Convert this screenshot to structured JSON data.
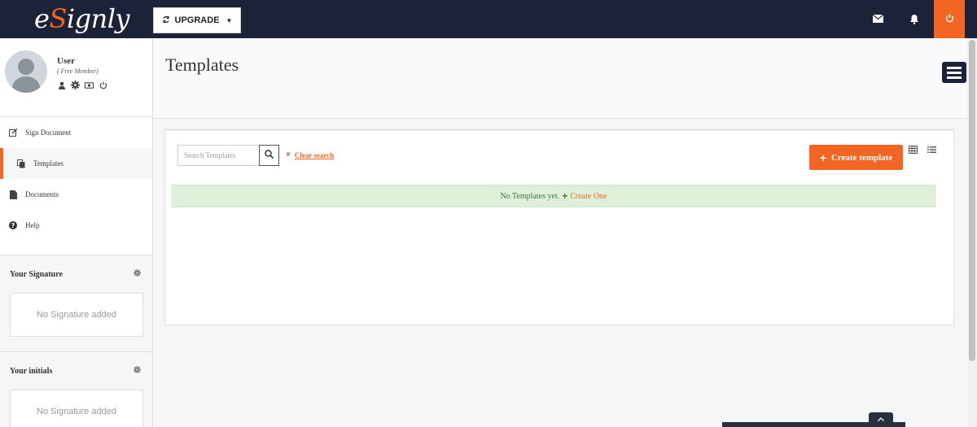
{
  "header": {
    "logo_text": "eSignly",
    "upgrade_label": "UPGRADE"
  },
  "profile": {
    "name": "User",
    "role": "( Free Member)"
  },
  "nav": {
    "items": [
      {
        "label": "Sign Document",
        "icon": "edit-icon"
      },
      {
        "label": "Templates",
        "icon": "copy-icon",
        "active": true
      },
      {
        "label": "Documents",
        "icon": "file-icon"
      },
      {
        "label": "Help",
        "icon": "help-icon"
      }
    ]
  },
  "signature": {
    "title": "Your Signature",
    "empty": "No Signature added"
  },
  "initials": {
    "title": "Your initials",
    "empty": "No Signature added"
  },
  "main": {
    "title": "Templates",
    "search_placeholder": "Search Templates",
    "clear_search": "Clear search",
    "create_label": "Create template",
    "empty_text": "No Templates yet.",
    "create_one": "Create One"
  },
  "colors": {
    "navy": "#1c2238",
    "accent": "#f26522",
    "success_bg": "#dff0d8",
    "success_text": "#3c763d"
  }
}
